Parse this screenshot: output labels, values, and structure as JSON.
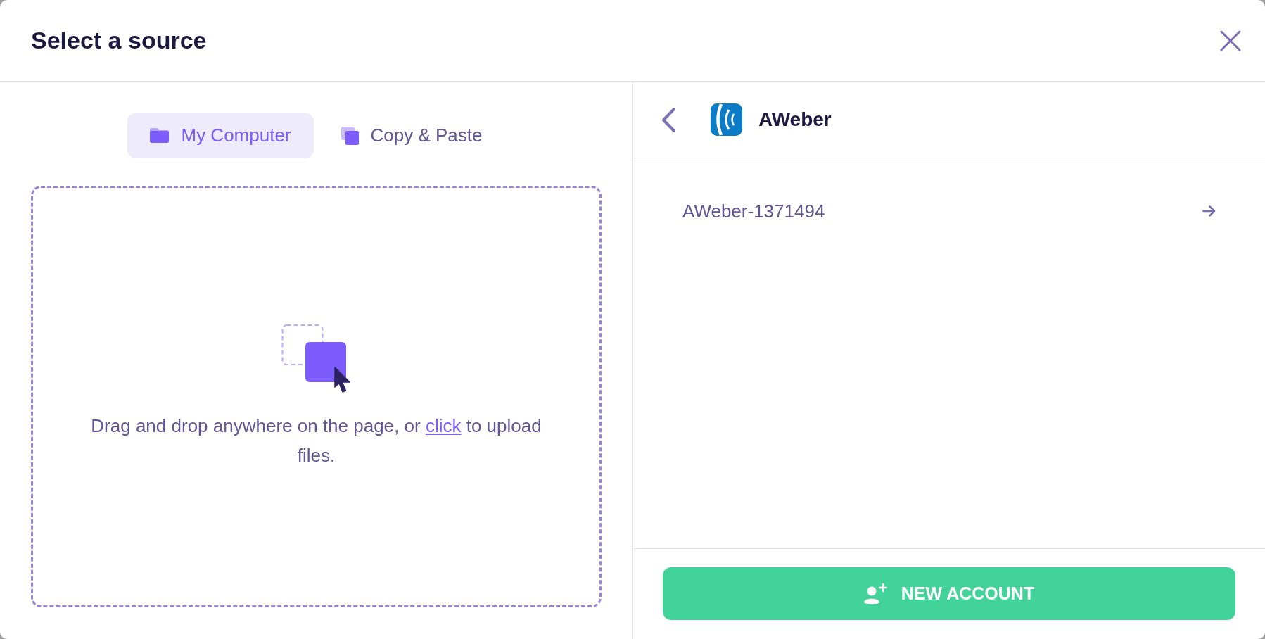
{
  "window": {
    "title": "Select a source"
  },
  "source_tabs": [
    {
      "label": "My Computer",
      "selected": true
    },
    {
      "label": "Copy & Paste",
      "selected": false
    }
  ],
  "drop_zone": {
    "text_before": "Drag and drop anywhere on the page, or ",
    "link": "click",
    "text_after": " to upload files."
  },
  "integration": {
    "name": "AWeber"
  },
  "accounts": [
    {
      "name": "AWeber-1371494"
    }
  ],
  "new_account_button": {
    "label": "NEW ACCOUNT"
  }
}
